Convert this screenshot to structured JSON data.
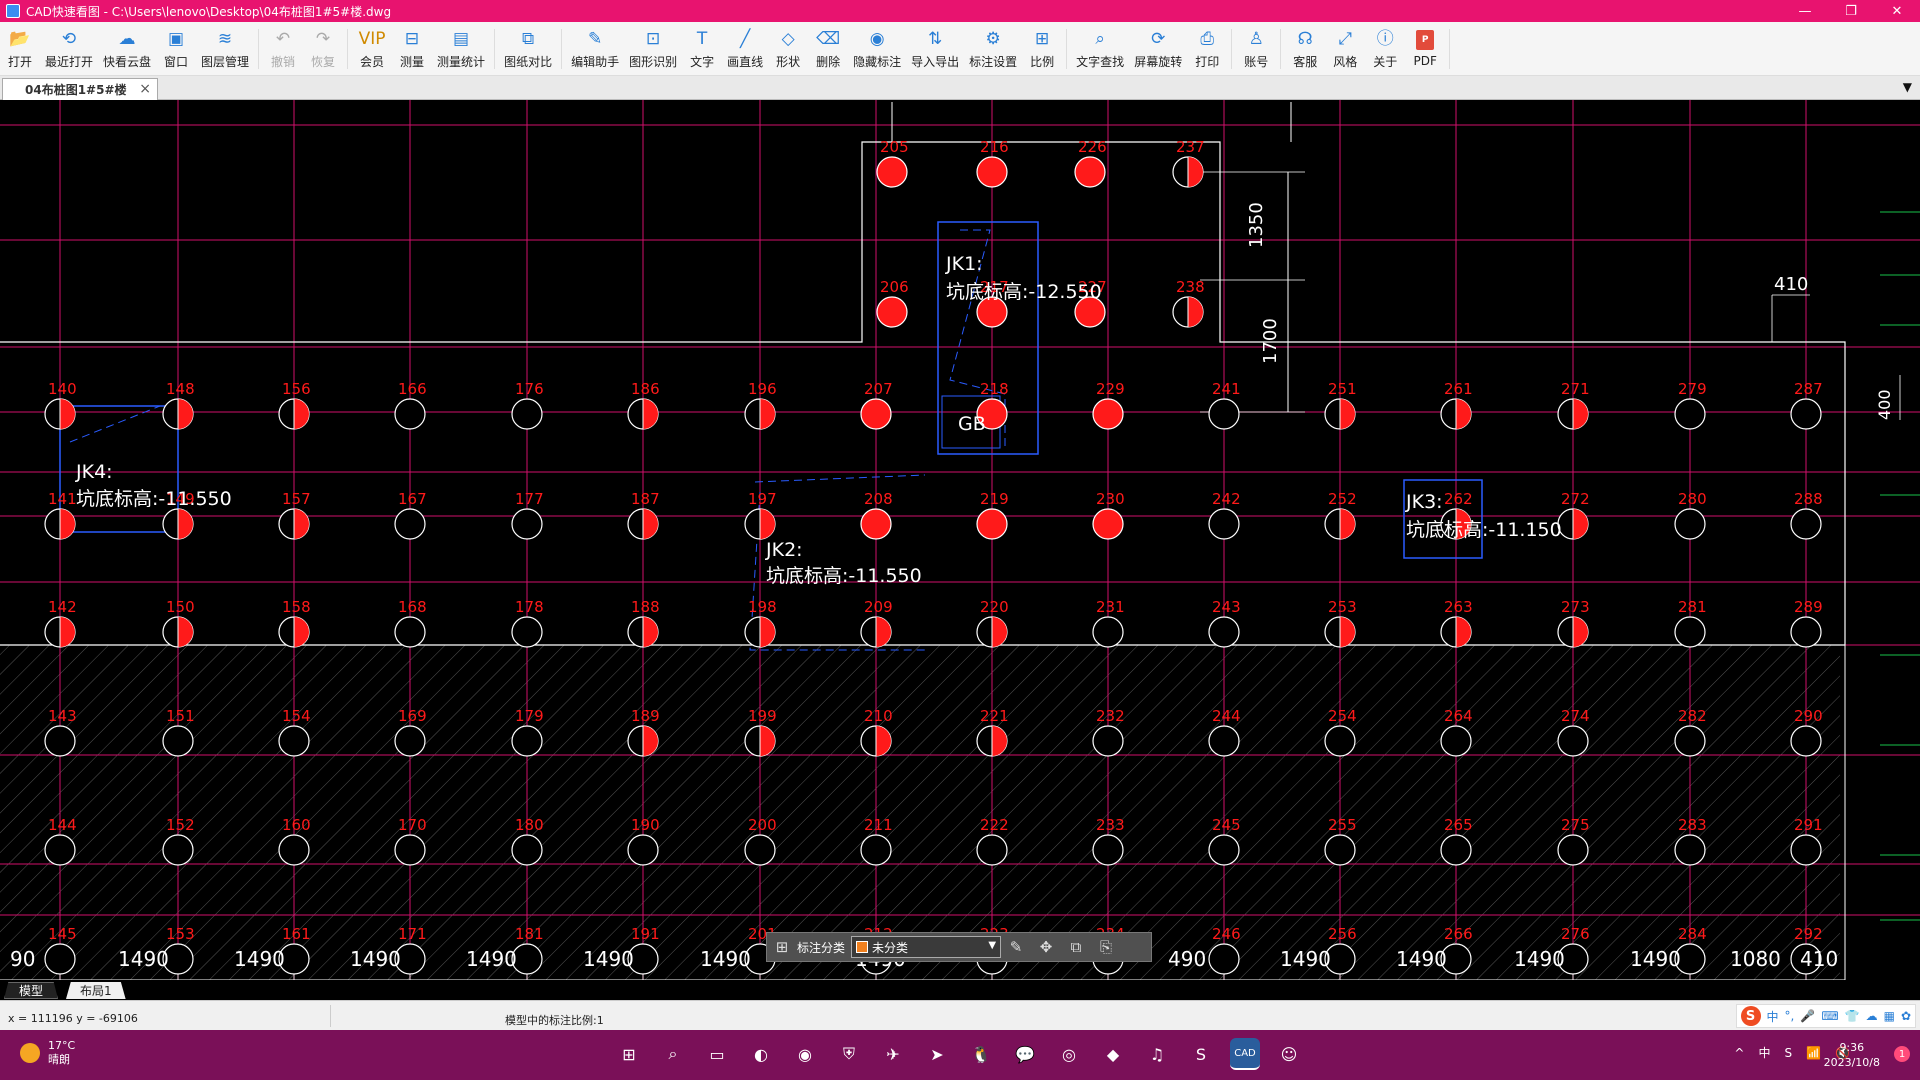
{
  "window": {
    "title": "CAD快速看图 - C:\\Users\\lenovo\\Desktop\\04布桩图1#5#楼.dwg",
    "minimize": "—",
    "maximize": "❐",
    "close": "✕"
  },
  "toolbar": [
    {
      "label": "打开",
      "icon": "folder-open-icon",
      "glyph": "📂"
    },
    {
      "label": "最近打开",
      "icon": "history-icon",
      "glyph": "⟲"
    },
    {
      "label": "快看云盘",
      "icon": "cloud-icon",
      "glyph": "☁"
    },
    {
      "label": "窗口",
      "icon": "window-icon",
      "glyph": "▣"
    },
    {
      "label": "图层管理",
      "icon": "layers-icon",
      "glyph": "≋"
    },
    {
      "label": "撤销",
      "icon": "undo-icon",
      "glyph": "↶",
      "disabled": true
    },
    {
      "label": "恢复",
      "icon": "redo-icon",
      "glyph": "↷",
      "disabled": true
    },
    {
      "label": "会员",
      "icon": "vip-icon",
      "glyph": "VIP",
      "vip": true
    },
    {
      "label": "测量",
      "icon": "ruler-icon",
      "glyph": "⊟"
    },
    {
      "label": "测量统计",
      "icon": "measure-stats-icon",
      "glyph": "▤"
    },
    {
      "label": "图纸对比",
      "icon": "compare-icon",
      "glyph": "⧉"
    },
    {
      "label": "编辑助手",
      "icon": "edit-assistant-icon",
      "glyph": "✎"
    },
    {
      "label": "图形识别",
      "icon": "shape-recognize-icon",
      "glyph": "⊡"
    },
    {
      "label": "文字",
      "icon": "text-icon",
      "glyph": "T"
    },
    {
      "label": "画直线",
      "icon": "line-icon",
      "glyph": "╱"
    },
    {
      "label": "形状",
      "icon": "shape-icon",
      "glyph": "◇"
    },
    {
      "label": "删除",
      "icon": "eraser-icon",
      "glyph": "⌫"
    },
    {
      "label": "隐藏标注",
      "icon": "hide-annotation-icon",
      "glyph": "◉"
    },
    {
      "label": "导入导出",
      "icon": "import-export-icon",
      "glyph": "⇅"
    },
    {
      "label": "标注设置",
      "icon": "annotation-settings-icon",
      "glyph": "⚙"
    },
    {
      "label": "比例",
      "icon": "scale-icon",
      "glyph": "⊞"
    },
    {
      "label": "文字查找",
      "icon": "text-search-icon",
      "glyph": "⌕"
    },
    {
      "label": "屏幕旋转",
      "icon": "rotate-screen-icon",
      "glyph": "⟳"
    },
    {
      "label": "打印",
      "icon": "printer-icon",
      "glyph": "⎙"
    },
    {
      "label": "账号",
      "icon": "account-icon",
      "glyph": "♙"
    },
    {
      "label": "客服",
      "icon": "headset-icon",
      "glyph": "☊"
    },
    {
      "label": "风格",
      "icon": "style-icon",
      "glyph": "⤢"
    },
    {
      "label": "关于",
      "icon": "info-icon",
      "glyph": "ⓘ"
    },
    {
      "label": "PDF",
      "icon": "pdf-icon",
      "glyph": "P",
      "pdf": true
    }
  ],
  "doc_tab": {
    "label": "04布桩图1#5#楼",
    "close": "×"
  },
  "tab_dropdown": "▼",
  "drawing": {
    "piles": [
      {
        "id": "205",
        "state": "full"
      },
      {
        "id": "216",
        "state": "full"
      },
      {
        "id": "226",
        "state": "full"
      },
      {
        "id": "237",
        "state": "half"
      },
      {
        "id": "206",
        "state": "full"
      },
      {
        "id": "217",
        "state": "full"
      },
      {
        "id": "227",
        "state": "full"
      },
      {
        "id": "238",
        "state": "half"
      },
      {
        "id": "140",
        "state": "half"
      },
      {
        "id": "148",
        "state": "half"
      },
      {
        "id": "156",
        "state": "half"
      },
      {
        "id": "166",
        "state": "empty"
      },
      {
        "id": "176",
        "state": "empty"
      },
      {
        "id": "186",
        "state": "half"
      },
      {
        "id": "196",
        "state": "half"
      },
      {
        "id": "207",
        "state": "full"
      },
      {
        "id": "218",
        "state": "full"
      },
      {
        "id": "229",
        "state": "full"
      },
      {
        "id": "241",
        "state": "empty"
      },
      {
        "id": "251",
        "state": "half"
      },
      {
        "id": "261",
        "state": "half"
      },
      {
        "id": "271",
        "state": "half"
      },
      {
        "id": "279",
        "state": "empty"
      },
      {
        "id": "287",
        "state": "empty"
      },
      {
        "id": "141",
        "state": "half"
      },
      {
        "id": "149",
        "state": "half"
      },
      {
        "id": "157",
        "state": "half"
      },
      {
        "id": "167",
        "state": "empty"
      },
      {
        "id": "177",
        "state": "empty"
      },
      {
        "id": "187",
        "state": "half"
      },
      {
        "id": "197",
        "state": "half"
      },
      {
        "id": "208",
        "state": "full"
      },
      {
        "id": "219",
        "state": "full"
      },
      {
        "id": "230",
        "state": "full"
      },
      {
        "id": "242",
        "state": "empty"
      },
      {
        "id": "252",
        "state": "half"
      },
      {
        "id": "262",
        "state": "half"
      },
      {
        "id": "272",
        "state": "half"
      },
      {
        "id": "280",
        "state": "empty"
      },
      {
        "id": "288",
        "state": "empty"
      },
      {
        "id": "142",
        "state": "half"
      },
      {
        "id": "150",
        "state": "half"
      },
      {
        "id": "158",
        "state": "half"
      },
      {
        "id": "168",
        "state": "empty"
      },
      {
        "id": "178",
        "state": "empty"
      },
      {
        "id": "188",
        "state": "half"
      },
      {
        "id": "198",
        "state": "half"
      },
      {
        "id": "209",
        "state": "half"
      },
      {
        "id": "220",
        "state": "half"
      },
      {
        "id": "231",
        "state": "empty"
      },
      {
        "id": "243",
        "state": "empty"
      },
      {
        "id": "253",
        "state": "half"
      },
      {
        "id": "263",
        "state": "half"
      },
      {
        "id": "273",
        "state": "half"
      },
      {
        "id": "281",
        "state": "empty"
      },
      {
        "id": "289",
        "state": "empty"
      },
      {
        "id": "143",
        "state": "empty"
      },
      {
        "id": "151",
        "state": "empty"
      },
      {
        "id": "154",
        "state": "empty"
      },
      {
        "id": "169",
        "state": "empty"
      },
      {
        "id": "179",
        "state": "empty"
      },
      {
        "id": "189",
        "state": "half"
      },
      {
        "id": "199",
        "state": "half"
      },
      {
        "id": "210",
        "state": "half"
      },
      {
        "id": "221",
        "state": "half"
      },
      {
        "id": "232",
        "state": "empty"
      },
      {
        "id": "244",
        "state": "empty"
      },
      {
        "id": "254",
        "state": "empty"
      },
      {
        "id": "264",
        "state": "empty"
      },
      {
        "id": "274",
        "state": "empty"
      },
      {
        "id": "282",
        "state": "empty"
      },
      {
        "id": "290",
        "state": "empty"
      },
      {
        "id": "144",
        "state": "empty"
      },
      {
        "id": "152",
        "state": "empty"
      },
      {
        "id": "160",
        "state": "empty"
      },
      {
        "id": "170",
        "state": "empty"
      },
      {
        "id": "180",
        "state": "empty"
      },
      {
        "id": "190",
        "state": "empty"
      },
      {
        "id": "200",
        "state": "empty"
      },
      {
        "id": "211",
        "state": "empty"
      },
      {
        "id": "222",
        "state": "empty"
      },
      {
        "id": "233",
        "state": "empty"
      },
      {
        "id": "245",
        "state": "empty"
      },
      {
        "id": "255",
        "state": "empty"
      },
      {
        "id": "265",
        "state": "empty"
      },
      {
        "id": "275",
        "state": "empty"
      },
      {
        "id": "283",
        "state": "empty"
      },
      {
        "id": "291",
        "state": "empty"
      },
      {
        "id": "145",
        "state": "empty"
      },
      {
        "id": "153",
        "state": "empty"
      },
      {
        "id": "161",
        "state": "empty"
      },
      {
        "id": "171",
        "state": "empty"
      },
      {
        "id": "181",
        "state": "empty"
      },
      {
        "id": "191",
        "state": "empty"
      },
      {
        "id": "201",
        "state": "empty"
      },
      {
        "id": "212",
        "state": "empty"
      },
      {
        "id": "223",
        "state": "empty"
      },
      {
        "id": "234",
        "state": "empty"
      },
      {
        "id": "246",
        "state": "empty"
      },
      {
        "id": "256",
        "state": "empty"
      },
      {
        "id": "266",
        "state": "empty"
      },
      {
        "id": "276",
        "state": "empty"
      },
      {
        "id": "284",
        "state": "empty"
      },
      {
        "id": "292",
        "state": "empty"
      }
    ],
    "labels": {
      "jk1_name": "JK1:",
      "jk1_elev": "坑底标高:-12.550",
      "jk2_name": "JK2:",
      "jk2_elev": "坑底标高:-11.550",
      "jk3_name": "JK3:",
      "jk3_elev": "坑底标高:-11.150",
      "jk4_name": "JK4:",
      "jk4_elev": "坑底标高:-11.550",
      "gb": "GB"
    },
    "dims": {
      "d1350": "1350",
      "d1700": "1700",
      "d410": "410",
      "d400": "400"
    },
    "bottom_dims": [
      "90",
      "1490",
      "1490",
      "1490",
      "1490",
      "1490",
      "1490",
      "1490",
      "490",
      "1490",
      "1490",
      "1490",
      "1490",
      "1080",
      "410"
    ]
  },
  "floatbar": {
    "label": "标注分类",
    "category": "未分类",
    "category_color": "#f0801f",
    "icons": [
      "grid-icon",
      "edit-icon",
      "move-icon",
      "copy-icon",
      "paste-icon"
    ]
  },
  "layout_tabs": {
    "model": "模型",
    "layout1": "布局1"
  },
  "status": {
    "coords": "x = 111196  y = -69106",
    "scale": "模型中的标注比例:1"
  },
  "ime": {
    "logo": "S",
    "items": [
      "中",
      "°,",
      "🎤",
      "⌨",
      "👕",
      "☁",
      "▦",
      "✿"
    ]
  },
  "taskbar": {
    "weather_temp": "17°C",
    "weather_desc": "晴朗",
    "apps": [
      {
        "name": "start-button",
        "glyph": "⊞"
      },
      {
        "name": "search-button",
        "glyph": "⌕"
      },
      {
        "name": "file-explorer",
        "glyph": "▭"
      },
      {
        "name": "app-orange",
        "glyph": "◐"
      },
      {
        "name": "edge-browser",
        "glyph": "◉"
      },
      {
        "name": "security-app",
        "glyph": "⛨"
      },
      {
        "name": "feishu-app",
        "glyph": "✈"
      },
      {
        "name": "dingtalk-app",
        "glyph": "➤"
      },
      {
        "name": "qq-app",
        "glyph": "🐧"
      },
      {
        "name": "wechat-app",
        "glyph": "💬"
      },
      {
        "name": "chrome-browser",
        "glyph": "◎"
      },
      {
        "name": "app-green",
        "glyph": "◆"
      },
      {
        "name": "netease-music",
        "glyph": "♫"
      },
      {
        "name": "wps-sheet",
        "glyph": "S"
      },
      {
        "name": "cad-viewer",
        "glyph": "CAD",
        "active": true
      },
      {
        "name": "app-avatar",
        "glyph": "☺"
      }
    ],
    "tray": [
      "^",
      "中",
      "S",
      "📶",
      "🔇"
    ],
    "time": "9:36",
    "date": "2023/10/8",
    "notif_count": "1"
  },
  "colors": {
    "titlebar": "#e8136f",
    "taskbar": "#7a1058",
    "grid_magenta": "#d0106a",
    "pile_red": "#ff1a1a",
    "outline_white": "#ffffff",
    "pit_blue": "#2a5cff"
  }
}
